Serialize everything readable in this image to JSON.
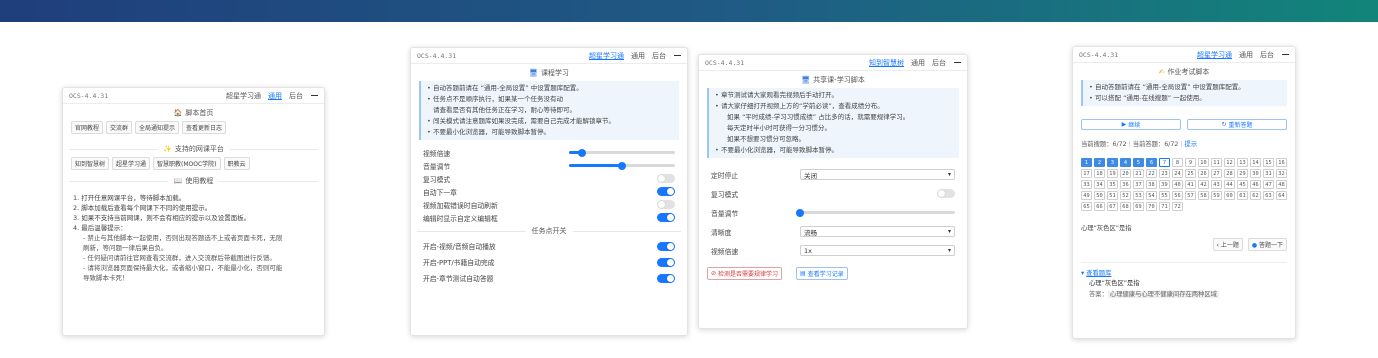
{
  "banner": {
    "colors": [
      "#1f3e7c",
      "#12857a"
    ]
  },
  "panel_home": {
    "version": "OCS-4.4.31",
    "tabs": [
      "超星学习通",
      "通用",
      "后台"
    ],
    "active_tab": 1,
    "script_home_title": "脚本首页",
    "links": [
      "官网教程",
      "交流群",
      "全局通知提示",
      "查看更新日志"
    ],
    "platforms_title": "支持的网课平台",
    "platforms": [
      "知到智慧树",
      "超星学习通",
      "智慧职教(MOOC学院)",
      "职教云"
    ],
    "tutorial_title": "使用教程",
    "steps": [
      "1. 打开任意网课平台，等待脚本加载。",
      "2. 脚本加载后查看每个网课下不同的使用提示。",
      "3. 如果不支持当前网课，则不会有相应的提示以及设置面板。",
      "4. 最后温馨提示：",
      "- 禁止与其他脚本一起使用，否则出现答题选不上或者页面卡死，无限",
      "刷新，等问题一律后果自负。",
      "- 任何疑问请前往官网查看交流群，进入交流群后带截图进行反馈。",
      "- 请将浏览器页面保持最大化，或者缩小窗口，不能最小化，否则可能",
      "导致脚本卡死！"
    ]
  },
  "panel_course": {
    "version": "OCS-4.4.31",
    "tabs": [
      "超星学习通",
      "通用",
      "后台"
    ],
    "active_tab": 0,
    "title": "课程学习",
    "tips": [
      "自动答题前请在 “通用-全局设置” 中设置题库配置。",
      "任务点不是顺序执行，如果某一个任务没有动",
      "请查看是否有其他任务正在学习，耐心等待即可。",
      "闯关模式请注意题库如果没完成，需要自己完成才能解锁章节。",
      "不要最小化浏览器，可能导致脚本暂停。"
    ],
    "settings": [
      {
        "label": "视频倍速",
        "type": "slider",
        "value": 0.12
      },
      {
        "label": "音量调节",
        "type": "slider",
        "value": 0.5
      },
      {
        "label": "复习模式",
        "type": "toggle",
        "on": false
      },
      {
        "label": "自动下一章",
        "type": "toggle",
        "on": true
      },
      {
        "label": "视频加载错误时自动刷新",
        "type": "toggle",
        "on": false
      },
      {
        "label": "编辑时显示自定义编辑框",
        "type": "toggle",
        "on": true
      }
    ],
    "switch_title": "任务点开关",
    "switches": [
      {
        "label": "开启-视频/音频自动播放",
        "on": true
      },
      {
        "label": "开启-PPT/书籍自动完成",
        "on": true
      },
      {
        "label": "开启-章节测试自动答题",
        "on": true
      }
    ]
  },
  "panel_share": {
    "version": "OCS-4.4.31",
    "tabs": [
      "知到智慧树",
      "通用",
      "后台"
    ],
    "active_tab": 0,
    "title": "共享课-学习脚本",
    "tips": [
      "章节测试请大家观看完视频后手动打开。",
      "请大家仔细打开视频上方的“学前必读”，查看成绩分布。",
      "如果 “平时成绩-学习习惯成绩” 占比多的话，就需要规律学习。",
      "每天定时半小时可获得一分习惯分。",
      "如果不想要习惯分可忽略。",
      "不要最小化浏览器，可能导致脚本暂停。"
    ],
    "settings": [
      {
        "label": "定时停止",
        "type": "select",
        "value": "关闭"
      },
      {
        "label": "复习模式",
        "type": "toggle",
        "on": false
      },
      {
        "label": "音量调节",
        "type": "slider",
        "value": 0.0
      },
      {
        "label": "清晰度",
        "type": "select",
        "value": "流畅"
      },
      {
        "label": "视频倍速",
        "type": "select",
        "value": "1x"
      }
    ],
    "btn_check": "检测是否需要规律学习",
    "btn_records": "查看学习记录"
  },
  "panel_homework": {
    "version": "OCS-4.4.31",
    "tabs": [
      "超星学习通",
      "通用",
      "后台"
    ],
    "active_tab": 0,
    "title": "作业考试脚本",
    "tips": [
      "自动答题前请在 “通用-全局设置” 中设置题库配置。",
      "可以搭配 “通用-在线搜题” 一起使用。"
    ],
    "btn_continue": "继续",
    "btn_restart": "重新答题",
    "progress": {
      "searched_label": "当前搜题：",
      "searched": "6/72",
      "answered_label": "当前答题：",
      "answered": "6/72",
      "hint": "提示"
    },
    "done_count": 6,
    "total": 72,
    "current": 7,
    "question_text": "心理“灰色区”是指",
    "btn_prev": "上一题",
    "btn_next": "答题一下",
    "result_header": "查看题库",
    "result_question": "心理“灰色区”是指",
    "result_answer_label": "答案：",
    "result_answer": "心理健康与心理不健康间存在两种区域"
  }
}
